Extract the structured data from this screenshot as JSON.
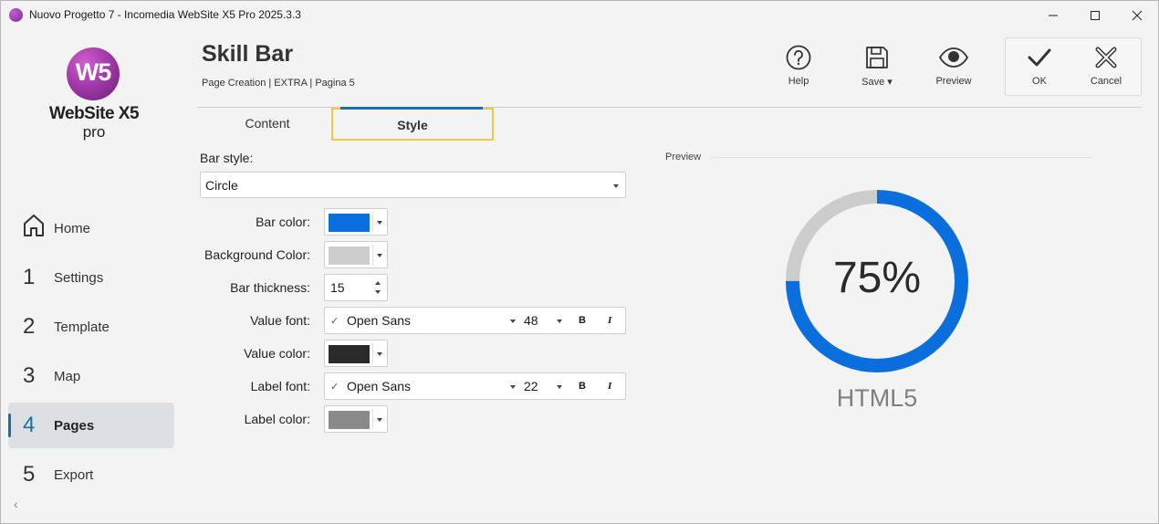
{
  "window": {
    "title": "Nuovo Progetto 7 - Incomedia WebSite X5 Pro 2025.3.3"
  },
  "logo": {
    "mark": "W5",
    "name": "WebSite X5",
    "edition": "pro"
  },
  "sidebar": {
    "items": [
      {
        "num": "",
        "label": "Home",
        "icon": "home-icon"
      },
      {
        "num": "1",
        "label": "Settings"
      },
      {
        "num": "2",
        "label": "Template"
      },
      {
        "num": "3",
        "label": "Map"
      },
      {
        "num": "4",
        "label": "Pages",
        "active": true
      },
      {
        "num": "5",
        "label": "Export"
      }
    ]
  },
  "header": {
    "title": "Skill Bar",
    "breadcrumb": "Page Creation | EXTRA | Pagina 5"
  },
  "toolbar": {
    "help": "Help",
    "save": "Save",
    "preview": "Preview",
    "ok": "OK",
    "cancel": "Cancel"
  },
  "tabs": [
    {
      "label": "Content"
    },
    {
      "label": "Style",
      "active": true
    }
  ],
  "form": {
    "bar_style_label": "Bar style:",
    "bar_style_value": "Circle",
    "bar_color_label": "Bar color:",
    "bar_color": "#0a6fdc",
    "background_color_label": "Background Color:",
    "background_color": "#cccccc",
    "bar_thickness_label": "Bar thickness:",
    "bar_thickness": "15",
    "value_font_label": "Value font:",
    "value_font_name": "Open Sans",
    "value_font_size": "48",
    "value_color_label": "Value color:",
    "value_color": "#2a2a2a",
    "label_font_label": "Label font:",
    "label_font_name": "Open Sans",
    "label_font_size": "22",
    "label_color_label": "Label color:",
    "label_color": "#8a8a8a",
    "bold": "B",
    "italic": "I"
  },
  "preview": {
    "heading": "Preview",
    "value_text": "75%",
    "progress": 0.75,
    "label_text": "HTML5"
  }
}
